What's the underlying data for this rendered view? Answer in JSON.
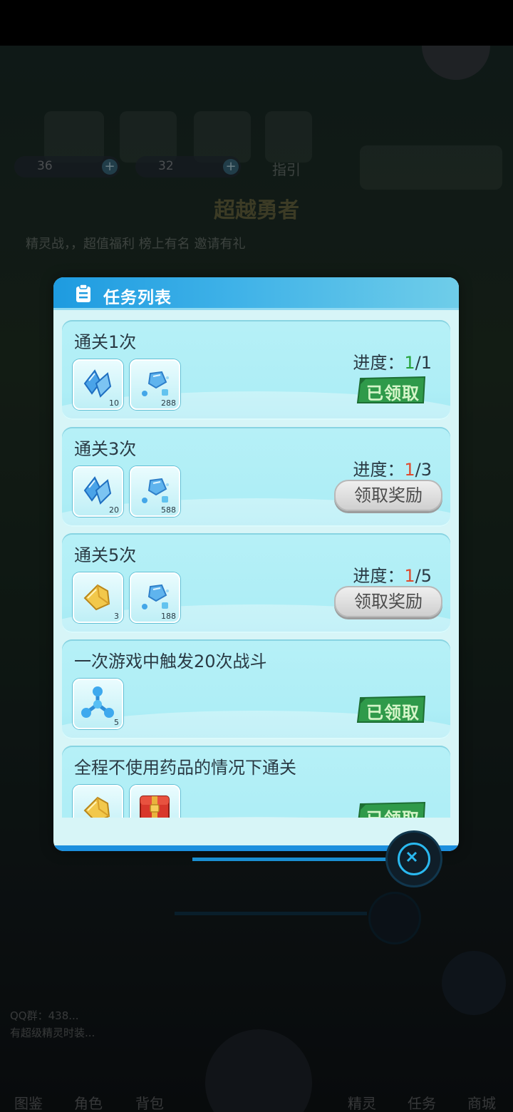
{
  "background": {
    "resource_1": "36",
    "resource_2": "32",
    "guide_label": "指引",
    "event_title": "超越勇者",
    "marquee_text": "精灵战，，超值福利 榜上有名 邀请有礼",
    "chat_line_1": "QQ群：438...",
    "chat_line_2": "有超级精灵时装...",
    "bottom_nav": [
      "图鉴",
      "角色",
      "背包",
      "",
      "精灵",
      "任务",
      "商城"
    ]
  },
  "dialog": {
    "title": "任务列表",
    "tasks": [
      {
        "title": "通关1次",
        "progress_label": "进度：",
        "progress_current": "1",
        "progress_total": "/1",
        "status": "已领取",
        "rewards": [
          {
            "icon": "blue-crystal-shards-icon",
            "count": "10"
          },
          {
            "icon": "blue-gems-icon",
            "count": "288"
          }
        ]
      },
      {
        "title": "通关3次",
        "progress_label": "进度：",
        "progress_current": "1",
        "progress_total": "/3",
        "status": "领取奖励",
        "rewards": [
          {
            "icon": "blue-crystal-shards-icon",
            "count": "20"
          },
          {
            "icon": "blue-gems-icon",
            "count": "588"
          }
        ]
      },
      {
        "title": "通关5次",
        "progress_label": "进度：",
        "progress_current": "1",
        "progress_total": "/5",
        "status": "领取奖励",
        "rewards": [
          {
            "icon": "gold-ore-icon",
            "count": "3"
          },
          {
            "icon": "blue-gems-icon",
            "count": "188"
          }
        ]
      },
      {
        "title": "一次游戏中触发20次战斗",
        "status": "已领取",
        "rewards": [
          {
            "icon": "blue-molecule-icon",
            "count": "5"
          }
        ]
      },
      {
        "title": "全程不使用药品的情况下通关",
        "status": "已领取",
        "rewards": [
          {
            "icon": "gold-ore-icon",
            "count": ""
          },
          {
            "icon": "red-treasure-chest-icon",
            "count": ""
          }
        ]
      }
    ]
  },
  "colors": {
    "header_blue": "#1e9be0",
    "dialog_bg": "#d7f5f7",
    "card_bg": "#aeeef6",
    "progress_done": "#27a33b",
    "progress_todo": "#e04a2e",
    "stamp_green": "#2f9a4a"
  }
}
